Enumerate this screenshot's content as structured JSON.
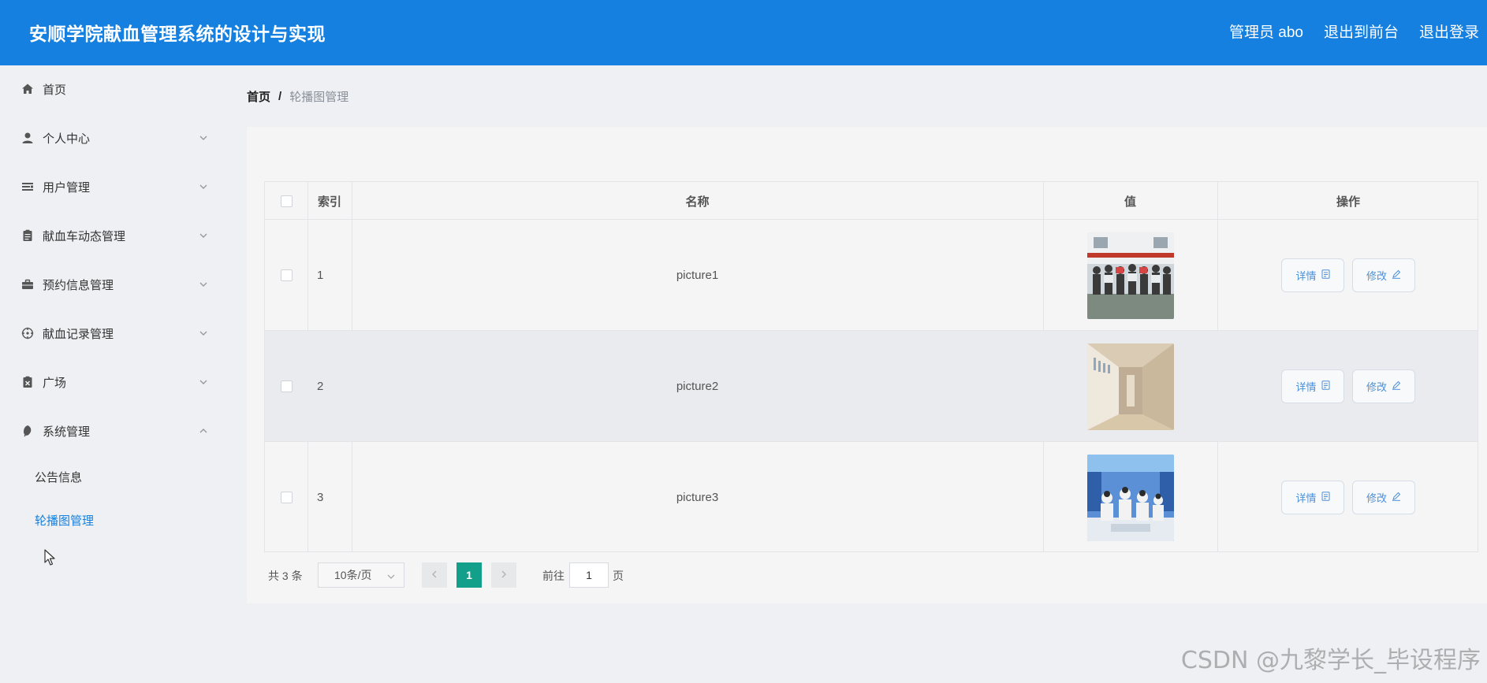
{
  "app": {
    "title": "安顺学院献血管理系统的设计与实现",
    "header_links": [
      "管理员 abo",
      "退出到前台",
      "退出登录"
    ]
  },
  "sidebar": {
    "items": [
      {
        "label": "首页",
        "icon": "home-icon"
      },
      {
        "label": "个人中心",
        "icon": "user-icon",
        "chevron": "down"
      },
      {
        "label": "用户管理",
        "icon": "list-icon",
        "chevron": "down"
      },
      {
        "label": "献血车动态管理",
        "icon": "clipboard-icon",
        "chevron": "down"
      },
      {
        "label": "预约信息管理",
        "icon": "briefcase-icon",
        "chevron": "down"
      },
      {
        "label": "献血记录管理",
        "icon": "target-icon",
        "chevron": "down"
      },
      {
        "label": "广场",
        "icon": "clipboard-x-icon",
        "chevron": "down"
      },
      {
        "label": "系统管理",
        "icon": "leaf-icon",
        "chevron": "up"
      }
    ],
    "sub_items": [
      {
        "label": "公告信息",
        "active": false
      },
      {
        "label": "轮播图管理",
        "active": true
      }
    ]
  },
  "breadcrumb": {
    "home": "首页",
    "separator": "/",
    "current": "轮播图管理"
  },
  "table": {
    "headers": {
      "index": "索引",
      "name": "名称",
      "value": "值",
      "actions": "操作"
    },
    "rows": [
      {
        "index": "1",
        "name": "picture1",
        "thumb": "blood-donation-group-photo"
      },
      {
        "index": "2",
        "name": "picture2",
        "thumb": "hallway-photo"
      },
      {
        "index": "3",
        "name": "picture3",
        "thumb": "donation-bus-interior-photo"
      }
    ],
    "detail_label": "详情",
    "edit_label": "修改"
  },
  "pagination": {
    "total_text": "共 3 条",
    "page_size": "10条/页",
    "current_page": "1",
    "goto_label": "前往",
    "goto_value": "1",
    "page_unit": "页"
  },
  "watermark": "CSDN @九黎学长_毕设程序",
  "colors": {
    "header_bg": "#1680e0",
    "active_menu": "#1680e0",
    "page_active": "#13a08a",
    "button_text": "#4a90d9"
  }
}
